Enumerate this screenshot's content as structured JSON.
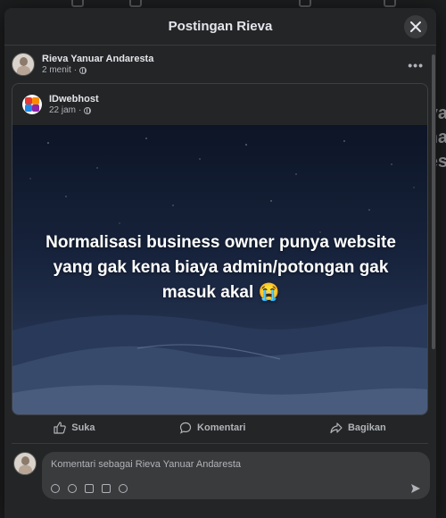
{
  "background": {
    "side_text": [
      "va",
      "ma",
      "es"
    ]
  },
  "modal": {
    "title": "Postingan Rieva"
  },
  "post": {
    "author": "Rieva Yanuar Andaresta",
    "time": "2 menit"
  },
  "shared_post": {
    "page_name": "IDwebhost",
    "time": "22 jam",
    "image_text": "Normalisasi business owner punya website yang gak kena biaya admin/potongan gak masuk akal 😭"
  },
  "actions": {
    "like": "Suka",
    "comment": "Komentari",
    "share": "Bagikan"
  },
  "comment": {
    "placeholder": "Komentari sebagai Rieva Yanuar Andaresta"
  },
  "colors": {
    "modal_bg": "#242526",
    "text_primary": "#e4e6eb",
    "text_secondary": "#b0b3b8",
    "image_gradient_top": "#0d1526",
    "image_gradient_bottom": "#2a3853"
  }
}
